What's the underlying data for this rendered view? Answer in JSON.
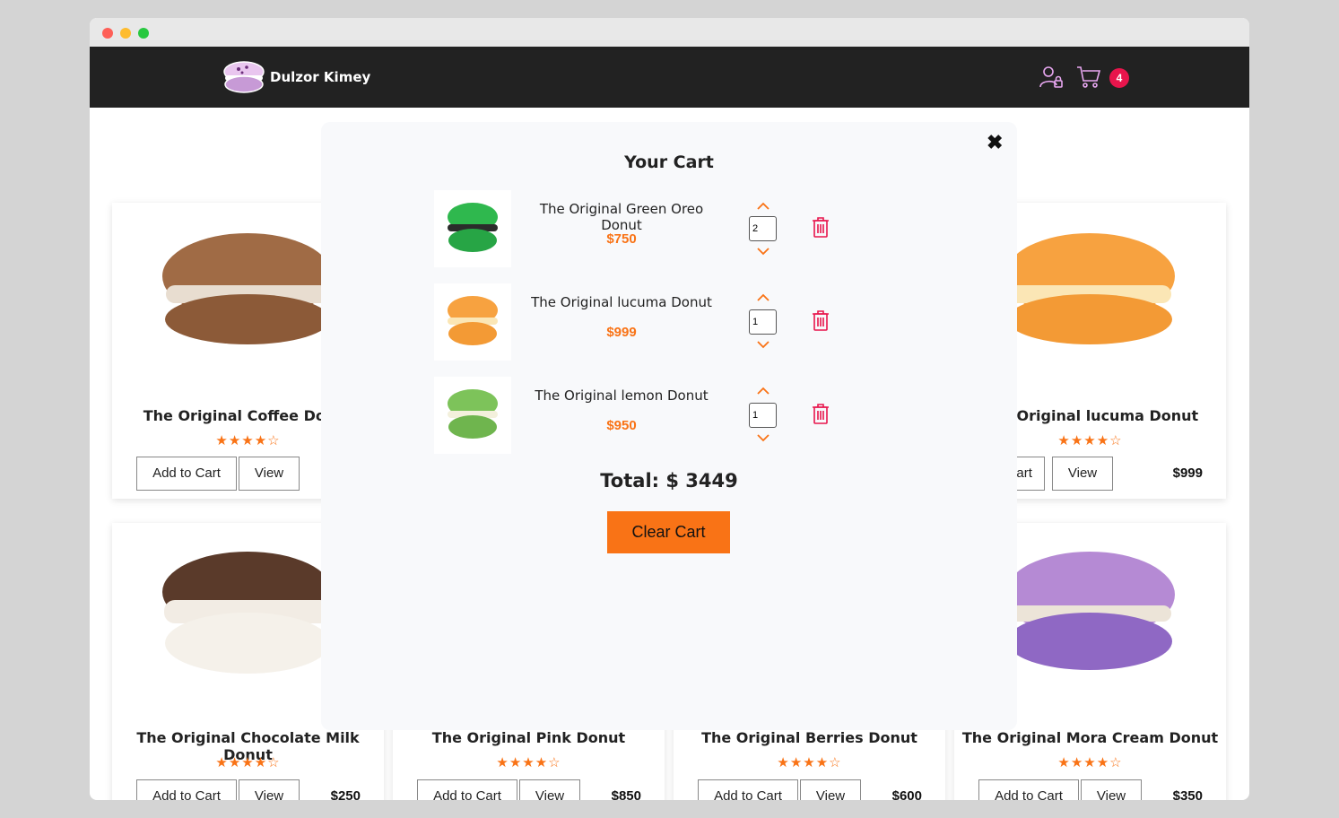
{
  "brand": {
    "name": "Dulzor Kimey"
  },
  "header": {
    "cart_count": "4"
  },
  "products": [
    {
      "name": "The Original Coffee Donut",
      "stars": "★★★★☆",
      "add_label": "Add to Cart",
      "view_label": "View",
      "price": "",
      "color": "#a06b45"
    },
    {
      "name": "The Original lucuma Donut",
      "stars": "★★★★☆",
      "add_label": "Add to Cart",
      "view_label": "View",
      "price": "$999",
      "color": "#f7a240"
    },
    {
      "name": "The Original Chocolate Milk Donut",
      "stars": "★★★★☆",
      "add_label": "Add to Cart",
      "view_label": "View",
      "price": "$250",
      "color": "#5a3a2a"
    },
    {
      "name": "The Original Pink Donut",
      "stars": "★★★★☆",
      "add_label": "Add to Cart",
      "view_label": "View",
      "price": "$850"
    },
    {
      "name": "The Original Berries Donut",
      "stars": "★★★★☆",
      "add_label": "Add to Cart",
      "view_label": "View",
      "price": "$600"
    },
    {
      "name": "The Original Mora Cream Donut",
      "stars": "★★★★☆",
      "add_label": "Add to Cart",
      "view_label": "View",
      "price": "$350",
      "color": "#a27ccb"
    }
  ],
  "cart": {
    "title": "Your Cart",
    "close_icon": "close-icon",
    "items": [
      {
        "name": "The Original Green Oreo Donut",
        "price": "$750",
        "qty": "2",
        "color": "#2fb84e"
      },
      {
        "name": "The Original lucuma Donut",
        "price": "$999",
        "qty": "1",
        "color": "#f7a240"
      },
      {
        "name": "The Original lemon Donut",
        "price": "$950",
        "qty": "1",
        "color": "#7dc35a"
      }
    ],
    "total": "Total: $ 3449",
    "clear_label": "Clear Cart"
  },
  "colors": {
    "accent": "#f97316",
    "badge": "#e8154c",
    "navbar": "#222222",
    "trash": "#e8154c"
  }
}
